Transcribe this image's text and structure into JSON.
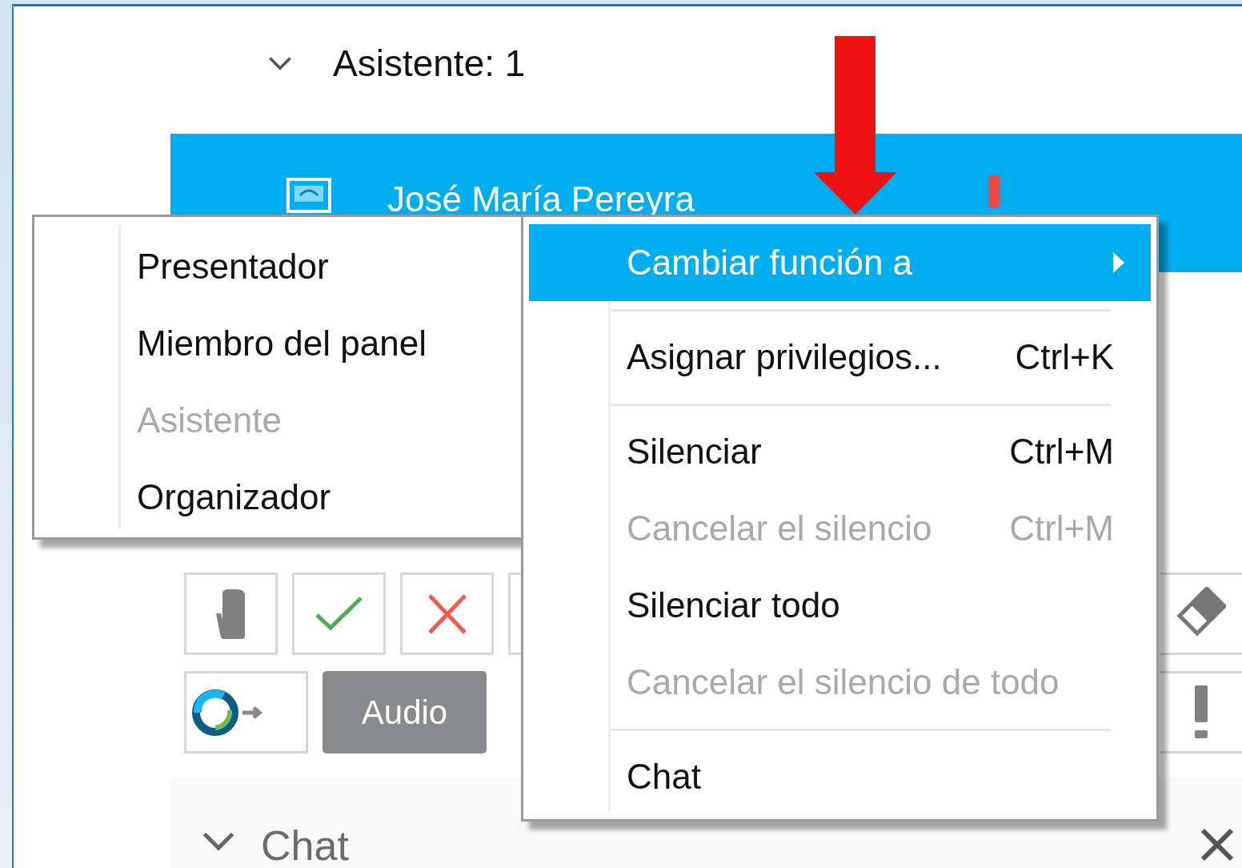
{
  "section": {
    "title": "Asistente: 1",
    "expanded": true
  },
  "participant": {
    "name": "José María Pereyra",
    "selected": true,
    "muted": false
  },
  "audio_button": {
    "label": "Audio"
  },
  "chat_section": {
    "title": "Chat",
    "expanded": true
  },
  "submenu": {
    "items": [
      {
        "label": "Presentador",
        "disabled": false
      },
      {
        "label": "Miembro del panel",
        "disabled": false
      },
      {
        "label": "Asistente",
        "disabled": true
      },
      {
        "label": "Organizador",
        "disabled": false
      }
    ]
  },
  "context_menu": {
    "items": [
      {
        "kind": "item",
        "label": "Cambiar función a",
        "disabled": false,
        "selected": true,
        "has_submenu": true
      },
      {
        "kind": "separator"
      },
      {
        "kind": "item",
        "label": "Asignar privilegios...",
        "shortcut": "Ctrl+K",
        "disabled": false,
        "selected": false,
        "has_submenu": false
      },
      {
        "kind": "separator"
      },
      {
        "kind": "item",
        "label": "Silenciar",
        "shortcut": "Ctrl+M",
        "disabled": false,
        "selected": false,
        "has_submenu": false
      },
      {
        "kind": "item",
        "label": "Cancelar el silencio",
        "shortcut": "Ctrl+M",
        "disabled": true,
        "selected": false,
        "has_submenu": false
      },
      {
        "kind": "item",
        "label": "Silenciar todo",
        "disabled": false,
        "selected": false,
        "has_submenu": false
      },
      {
        "kind": "item",
        "label": "Cancelar el silencio de todo",
        "disabled": true,
        "selected": false,
        "has_submenu": false
      },
      {
        "kind": "separator"
      },
      {
        "kind": "item",
        "label": "Chat",
        "disabled": false,
        "selected": false,
        "has_submenu": false
      }
    ]
  }
}
